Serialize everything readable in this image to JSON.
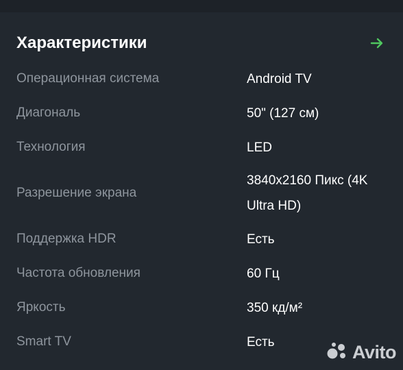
{
  "header": {
    "title": "Характеристики",
    "arrow_icon": "arrow-right-icon",
    "arrow_color": "#4fc65f"
  },
  "specs": [
    {
      "label": "Операционная система",
      "value": "Android TV"
    },
    {
      "label": "Диагональ",
      "value": "50\" (127 см)"
    },
    {
      "label": "Технология",
      "value": "LED"
    },
    {
      "label": "Разрешение экрана",
      "value": "3840x2160 Пикс (4K Ultra HD)"
    },
    {
      "label": "Поддержка HDR",
      "value": "Есть"
    },
    {
      "label": "Частота обновления",
      "value": "60 Гц"
    },
    {
      "label": "Яркость",
      "value": "350 кд/м²"
    },
    {
      "label": "Smart TV",
      "value": "Есть"
    }
  ],
  "watermark": {
    "text": "Avito",
    "logo_icon": "avito-logo-icon"
  },
  "colors": {
    "background": "#22282f",
    "label": "#8e959d",
    "value": "#ffffff",
    "accent": "#4fc65f"
  }
}
